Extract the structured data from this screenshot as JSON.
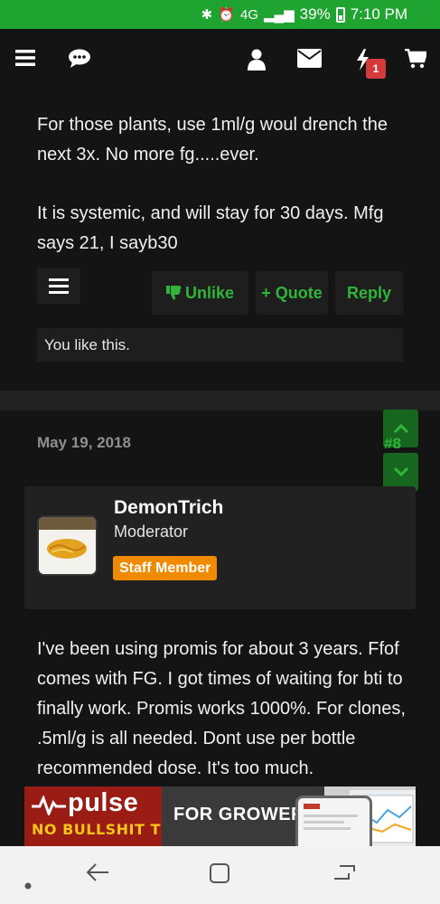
{
  "status_bar": {
    "battery": "39%",
    "time": "7:10 PM",
    "network": "4G"
  },
  "nav": {
    "menu_icon": "hamburger-icon",
    "chat_icon": "chat-bubble-icon",
    "user_icon": "user-icon",
    "mail_icon": "envelope-icon",
    "alerts_icon": "lightning-icon",
    "alerts_count": "1",
    "cart_icon": "cart-icon"
  },
  "post1": {
    "paragraph1": "For those plants, use 1ml/g woul drench the next 3x. No more fg.....ever.",
    "paragraph2": "It is systemic, and will stay for 30 days. Mfg says 21, I sayb30",
    "unlike_label": "Unlike",
    "quote_label": "+ Quote",
    "reply_label": "Reply",
    "likes_text": "You like this."
  },
  "post2": {
    "date": "May 19, 2018",
    "post_number": "#8",
    "username": "DemonTrich",
    "user_title": "Moderator",
    "staff_badge": "Staff Member",
    "body": "I've been using promis for about 3 years. Ffof comes with FG. I got times of waiting for bti to finally work. Promis works 1000%. For clones, .5ml/g is all needed. Dont use per bottle recommended dose. It's too much."
  },
  "ad": {
    "logo": "pulse",
    "tagline": "NO BULLSHIT TECH",
    "headline": "FOR GROWERS"
  },
  "colors": {
    "accent": "#2fb53a",
    "status_bar": "#1fa431",
    "badge": "#f08a00",
    "background": "#141414"
  }
}
